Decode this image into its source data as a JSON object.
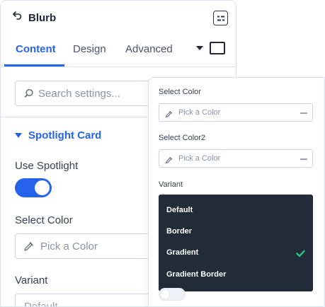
{
  "header": {
    "title": "Blurb",
    "back_icon": "back-arrow-icon",
    "menu_icon": "panel-menu-icon"
  },
  "tabs": [
    {
      "label": "Content",
      "active": true
    },
    {
      "label": "Design",
      "active": false
    },
    {
      "label": "Advanced",
      "active": false
    }
  ],
  "search": {
    "placeholder": "Search settings..."
  },
  "section": {
    "title": "Spotlight Card",
    "expanded": true
  },
  "fields": {
    "use_spotlight_label": "Use Spotlight",
    "use_spotlight_value": true,
    "select_color_label": "Select Color",
    "select_color_placeholder": "Pick a Color",
    "variant_label": "Variant",
    "variant_value": "Default"
  },
  "popup": {
    "select_color_label": "Select Color",
    "select_color_placeholder": "Pick a Color",
    "select_color2_label": "Select Color2",
    "select_color2_placeholder": "Pick a Color",
    "variant_label": "Variant",
    "variant_options": [
      "Default",
      "Border",
      "Gradient",
      "Gradient Border"
    ],
    "variant_selected": "Gradient",
    "toggle_value": false
  },
  "colors": {
    "accent": "#2563eb",
    "dropdown_bg": "#222b38",
    "check": "#22c58b"
  }
}
